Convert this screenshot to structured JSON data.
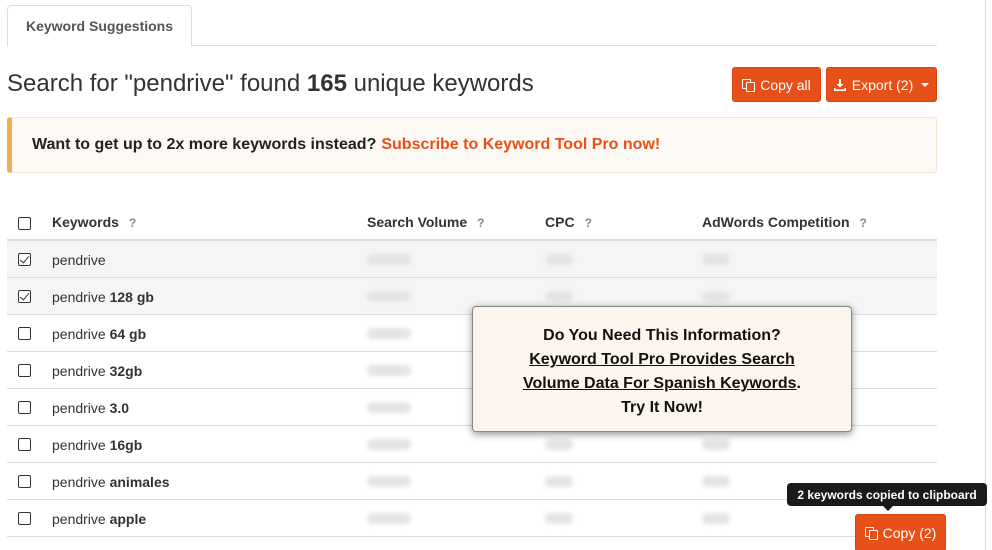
{
  "tabs": [
    {
      "label": "Keyword Suggestions"
    }
  ],
  "heading": {
    "prefix": "Search for \"pendrive\" found ",
    "count": "165",
    "suffix": " unique keywords"
  },
  "toolbar": {
    "copy_all_label": "Copy all",
    "export_label": "Export (2)"
  },
  "alert": {
    "text": "Want to get up to 2x more keywords instead?",
    "link": "Subscribe to Keyword Tool Pro now!"
  },
  "table": {
    "columns": {
      "keywords": "Keywords",
      "search_volume": "Search Volume",
      "cpc": "CPC",
      "competition": "AdWords Competition",
      "help": "?"
    },
    "rows": [
      {
        "base": "pendrive",
        "suffix": "",
        "checked": true
      },
      {
        "base": "pendrive ",
        "suffix": "128 gb",
        "checked": true
      },
      {
        "base": "pendrive ",
        "suffix": "64 gb",
        "checked": false
      },
      {
        "base": "pendrive ",
        "suffix": "32gb",
        "checked": false
      },
      {
        "base": "pendrive ",
        "suffix": "3.0",
        "checked": false
      },
      {
        "base": "pendrive ",
        "suffix": "16gb",
        "checked": false
      },
      {
        "base": "pendrive ",
        "suffix": "animales",
        "checked": false
      },
      {
        "base": "pendrive ",
        "suffix": "apple",
        "checked": false
      }
    ]
  },
  "popup": {
    "line1": "Do You Need This Information?",
    "line2": "Keyword Tool Pro Provides Search",
    "line3": "Volume Data For Spanish Keywords",
    "line3_tail": ".",
    "line4": "Try It Now!"
  },
  "tooltip": {
    "text": "2 keywords copied to clipboard"
  },
  "copy_button": {
    "label": "Copy (2)"
  },
  "colors": {
    "accent": "#e8501a",
    "alert_border": "#f0ad4e",
    "popup_bg": "#fbf5ee"
  }
}
